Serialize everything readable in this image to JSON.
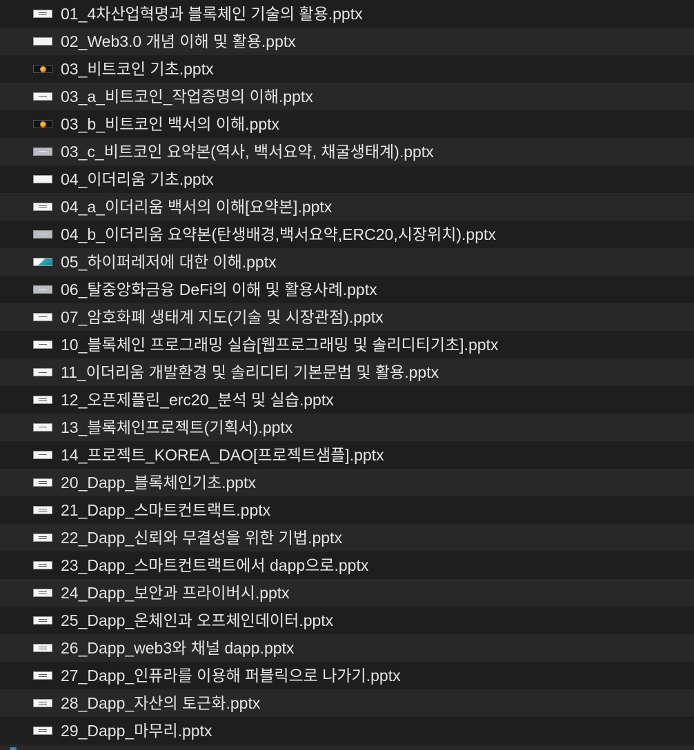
{
  "files": [
    {
      "name": "01_4차산업혁명과 블록체인 기술의 활용.pptx",
      "thumb": "white",
      "thumb_icon": "slide-thumbnail-icon"
    },
    {
      "name": "02_Web3.0 개념 이해 및 활용.pptx",
      "thumb": "white",
      "thumb_icon": "slide-thumbnail-icon"
    },
    {
      "name": "03_비트코인 기초.pptx",
      "thumb": "dark",
      "thumb_icon": "bitcoin-slide-thumbnail-icon"
    },
    {
      "name": "03_a_비트코인_작업증명의 이해.pptx",
      "thumb": "white",
      "thumb_icon": "slide-thumbnail-icon"
    },
    {
      "name": "03_b_비트코인 백서의 이해.pptx",
      "thumb": "dark",
      "thumb_icon": "bitcoin-slide-thumbnail-icon"
    },
    {
      "name": "03_c_비트코인 요약본(역사, 백서요약, 채굴생태계).pptx",
      "thumb": "gray",
      "thumb_icon": "slide-thumbnail-icon"
    },
    {
      "name": "04_이더리움 기초.pptx",
      "thumb": "white",
      "thumb_icon": "slide-thumbnail-icon"
    },
    {
      "name": "04_a_이더리움 백서의 이해[요약본].pptx",
      "thumb": "white",
      "thumb_icon": "slide-thumbnail-icon"
    },
    {
      "name": "04_b_이더리움 요약본(탄생배경,백서요약,ERC20,시장위치).pptx",
      "thumb": "gray",
      "thumb_icon": "slide-thumbnail-icon"
    },
    {
      "name": "05_하이퍼레저에 대한 이해.pptx",
      "thumb": "teal",
      "thumb_icon": "slide-thumbnail-icon"
    },
    {
      "name": "06_탈중앙화금융 DeFi의 이해 및 활용사례.pptx",
      "thumb": "gray",
      "thumb_icon": "slide-thumbnail-icon"
    },
    {
      "name": "07_암호화폐 생태계 지도(기술 및 시장관점).pptx",
      "thumb": "white",
      "thumb_icon": "slide-thumbnail-icon"
    },
    {
      "name": "10_블록체인 프로그래밍 실습[웹프로그래밍 및 솔리디티기초].pptx",
      "thumb": "white",
      "thumb_icon": "slide-thumbnail-icon"
    },
    {
      "name": "11_이더리움 개발환경 및 솔리디티 기본문법 및 활용.pptx",
      "thumb": "white",
      "thumb_icon": "slide-thumbnail-icon"
    },
    {
      "name": "12_오픈제플린_erc20_분석 및 실습.pptx",
      "thumb": "white",
      "thumb_icon": "slide-thumbnail-icon"
    },
    {
      "name": "13_블록체인프로젝트(기획서).pptx",
      "thumb": "white",
      "thumb_icon": "slide-thumbnail-icon"
    },
    {
      "name": "14_프로젝트_KOREA_DAO[프로젝트샘플].pptx",
      "thumb": "white",
      "thumb_icon": "slide-thumbnail-icon"
    },
    {
      "name": "20_Dapp_블록체인기초.pptx",
      "thumb": "white",
      "thumb_icon": "slide-thumbnail-icon"
    },
    {
      "name": "21_Dapp_스마트컨트랙트.pptx",
      "thumb": "white",
      "thumb_icon": "slide-thumbnail-icon"
    },
    {
      "name": "22_Dapp_신뢰와 무결성을 위한 기법.pptx",
      "thumb": "white",
      "thumb_icon": "slide-thumbnail-icon"
    },
    {
      "name": "23_Dapp_스마트컨트랙트에서 dapp으로.pptx",
      "thumb": "white",
      "thumb_icon": "slide-thumbnail-icon"
    },
    {
      "name": "24_Dapp_보안과 프라이버시.pptx",
      "thumb": "white",
      "thumb_icon": "slide-thumbnail-icon"
    },
    {
      "name": "25_Dapp_온체인과 오프체인데이터.pptx",
      "thumb": "white",
      "thumb_icon": "slide-thumbnail-icon"
    },
    {
      "name": "26_Dapp_web3와 채널 dapp.pptx",
      "thumb": "white",
      "thumb_icon": "slide-thumbnail-icon"
    },
    {
      "name": "27_Dapp_인퓨라를 이용해 퍼블릭으로 나가기.pptx",
      "thumb": "white",
      "thumb_icon": "slide-thumbnail-icon"
    },
    {
      "name": "28_Dapp_자산의 토근화.pptx",
      "thumb": "white",
      "thumb_icon": "slide-thumbnail-icon"
    },
    {
      "name": "29_Dapp_마무리.pptx",
      "thumb": "white",
      "thumb_icon": "slide-thumbnail-icon"
    }
  ],
  "colors": {
    "row_bg": "#1e1e1e",
    "row_alt_bg": "#282828",
    "text": "#e6e6e6"
  }
}
